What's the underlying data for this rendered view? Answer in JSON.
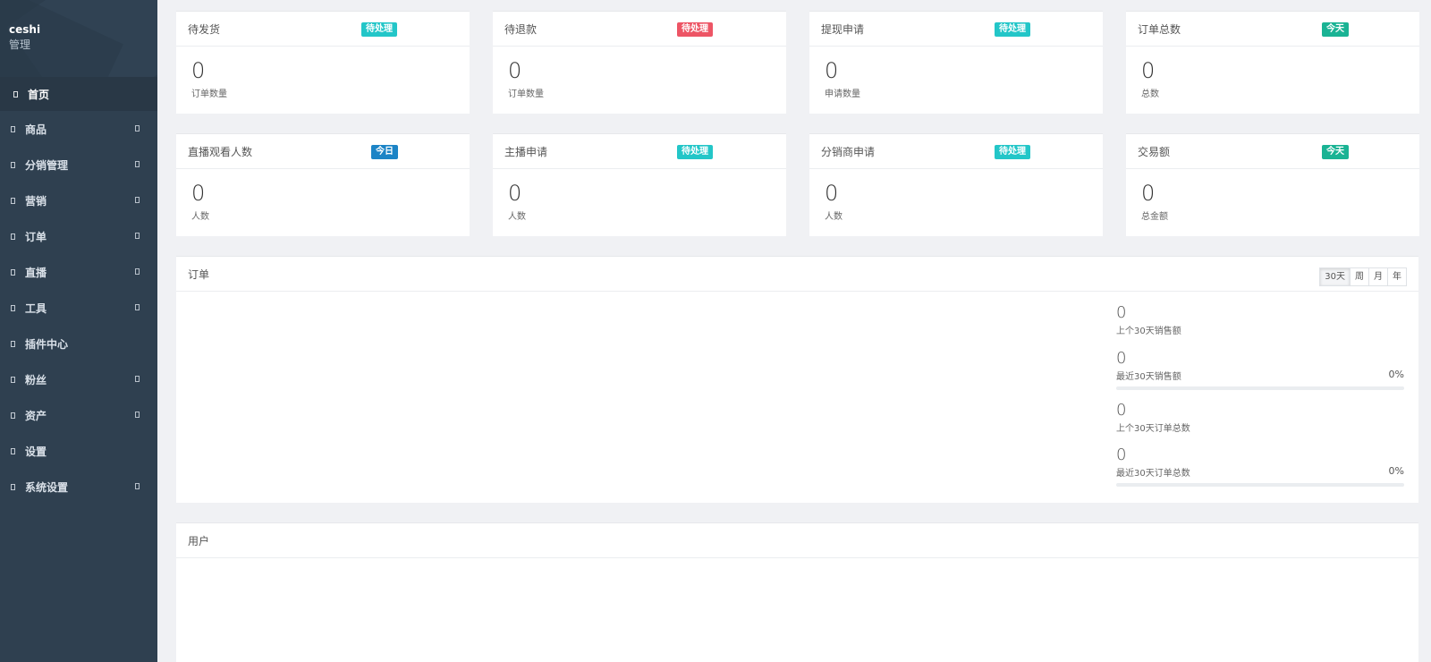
{
  "colors": {
    "teal": "#23c6c8",
    "red": "#ed5565",
    "blue": "#1c84c6",
    "green": "#1ab394",
    "sidebar": "#2f4050"
  },
  "sidebar": {
    "brand_name": "ceshi",
    "brand_role": "管理",
    "items": [
      {
        "label": "首页",
        "icon": "home-icon",
        "has_sub": false
      },
      {
        "label": "商品",
        "icon": "goods-icon",
        "has_sub": true
      },
      {
        "label": "分销管理",
        "icon": "distribution-icon",
        "has_sub": true
      },
      {
        "label": "营销",
        "icon": "marketing-icon",
        "has_sub": true
      },
      {
        "label": "订单",
        "icon": "order-icon",
        "has_sub": true
      },
      {
        "label": "直播",
        "icon": "live-icon",
        "has_sub": true
      },
      {
        "label": "工具",
        "icon": "tools-icon",
        "has_sub": true
      },
      {
        "label": "插件中心",
        "icon": "plugin-icon",
        "has_sub": false
      },
      {
        "label": "粉丝",
        "icon": "fans-icon",
        "has_sub": true
      },
      {
        "label": "资产",
        "icon": "assets-icon",
        "has_sub": true
      },
      {
        "label": "设置",
        "icon": "settings-icon",
        "has_sub": false
      },
      {
        "label": "系统设置",
        "icon": "system-icon",
        "has_sub": true
      }
    ]
  },
  "cards": [
    {
      "title": "待发货",
      "badge": "待处理",
      "badge_color": "teal",
      "value": "0",
      "sub": "订单数量"
    },
    {
      "title": "待退款",
      "badge": "待处理",
      "badge_color": "red",
      "value": "0",
      "sub": "订单数量"
    },
    {
      "title": "提现申请",
      "badge": "待处理",
      "badge_color": "teal",
      "value": "0",
      "sub": "申请数量"
    },
    {
      "title": "订单总数",
      "badge": "今天",
      "badge_color": "green",
      "value": "0",
      "sub": "总数"
    },
    {
      "title": "直播观看人数",
      "badge": "今日",
      "badge_color": "blue",
      "value": "0",
      "sub": "人数"
    },
    {
      "title": "主播申请",
      "badge": "待处理",
      "badge_color": "teal",
      "value": "0",
      "sub": "人数"
    },
    {
      "title": "分销商申请",
      "badge": "待处理",
      "badge_color": "teal",
      "value": "0",
      "sub": "人数"
    },
    {
      "title": "交易额",
      "badge": "今天",
      "badge_color": "green",
      "value": "0",
      "sub": "总金额"
    }
  ],
  "orders": {
    "title": "订单",
    "ranges": [
      "30天",
      "周",
      "月",
      "年"
    ],
    "selected_range": "30天",
    "metrics": [
      {
        "value": "0",
        "label": "上个30天销售额"
      },
      {
        "value": "0",
        "label": "最近30天销售额",
        "percent": "0%",
        "progress": 0
      },
      {
        "value": "0",
        "label": "上个30天订单总数"
      },
      {
        "value": "0",
        "label": "最近30天订单总数",
        "percent": "0%",
        "progress": 0
      }
    ]
  },
  "users": {
    "title": "用户"
  }
}
